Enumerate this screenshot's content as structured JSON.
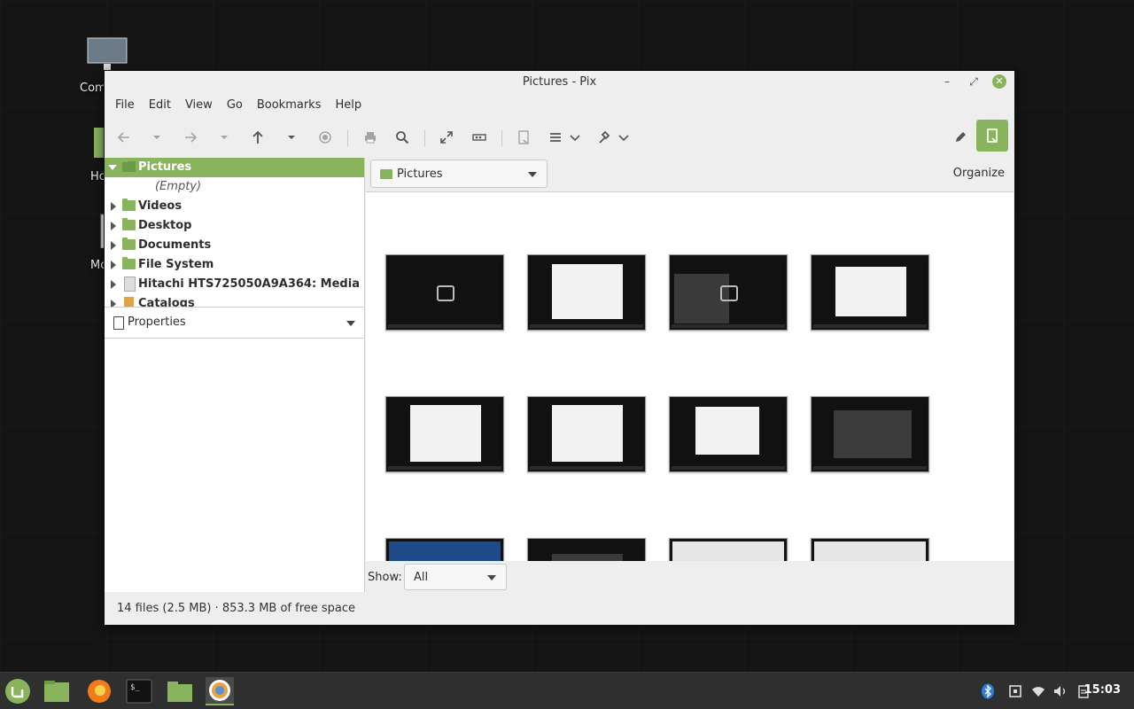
{
  "desktop": {
    "icons": [
      {
        "label": "Com"
      },
      {
        "label": "Ho"
      },
      {
        "label": "Mo"
      }
    ]
  },
  "window": {
    "title": "Pictures - Pix",
    "controls": {
      "minimize": "–",
      "maximize": "⤢",
      "close": "✕"
    }
  },
  "menubar": [
    "File",
    "Edit",
    "View",
    "Go",
    "Bookmarks",
    "Help"
  ],
  "toolbar": {
    "items": [
      "back-icon",
      "back-history-icon",
      "forward-icon",
      "forward-history-icon",
      "up-icon",
      "up-history-icon",
      "stop-icon",
      "print-icon",
      "search-icon",
      "fullscreen-icon",
      "slideshow-icon",
      "properties-icon",
      "view-list-icon",
      "tools-icon",
      "edit-icon",
      "properties-toggle-icon"
    ]
  },
  "tree": {
    "items": [
      {
        "label": "Pictures",
        "selected": true,
        "expanded": true
      },
      {
        "label": "(Empty)",
        "placeholder": true
      },
      {
        "label": "Videos"
      },
      {
        "label": "Desktop"
      },
      {
        "label": "Documents"
      },
      {
        "label": "File System"
      },
      {
        "label": "Hitachi HTS725050A9A364: Media"
      },
      {
        "label": "Catalogs"
      }
    ]
  },
  "properties": {
    "label": "Properties"
  },
  "location": {
    "label": "Pictures"
  },
  "organize_label": "Organize",
  "show": {
    "label": "Show:",
    "value": "All"
  },
  "status": "14 files (2.5 MB) · 853.3 MB of free space",
  "thumbnails_count": 12,
  "taskbar": {
    "apps": [
      "mint-menu-icon",
      "files-icon",
      "firefox-icon",
      "terminal-icon",
      "folder-icon",
      "pix-icon"
    ],
    "tray": [
      "bluetooth-icon",
      "screenshot-icon",
      "wifi-icon",
      "volume-icon",
      "clipboard-icon"
    ],
    "clock": "15:03"
  },
  "colors": {
    "accent": "#8ab35d",
    "taskbar": "#2f2f2f",
    "desktop": "#151515"
  }
}
